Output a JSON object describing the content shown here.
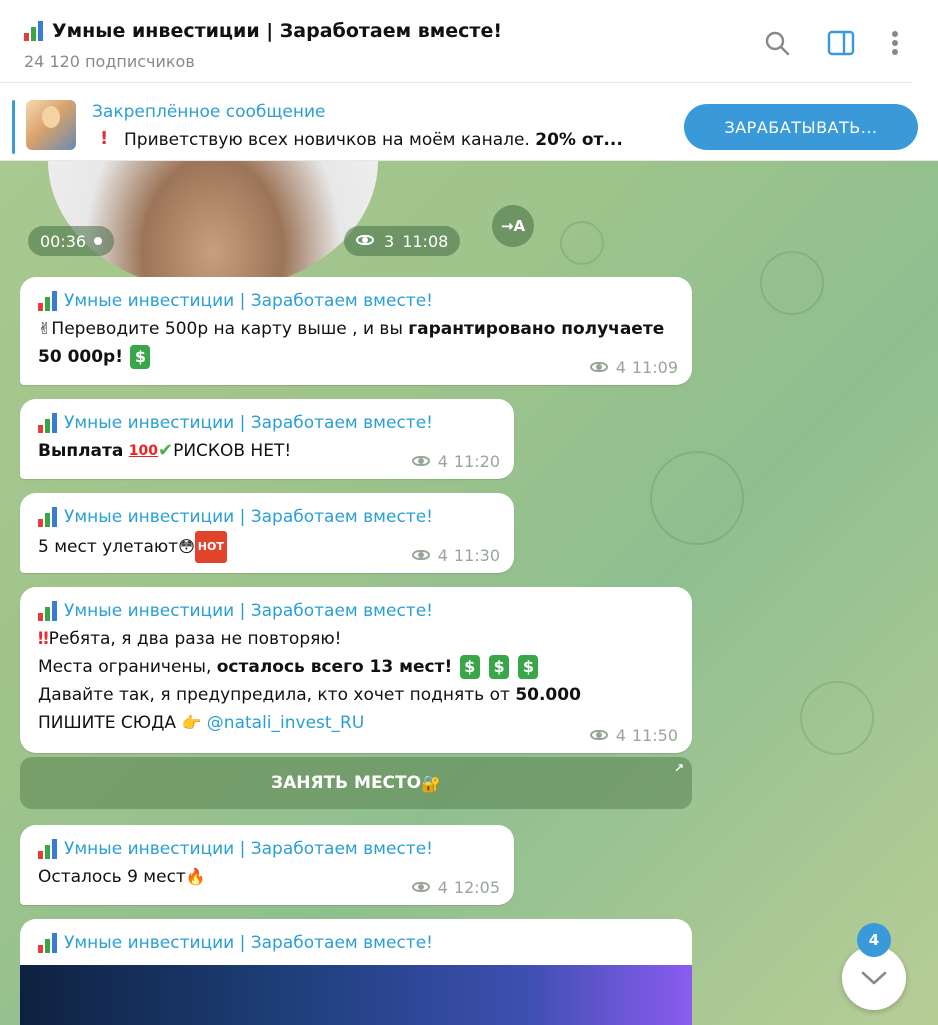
{
  "header": {
    "title": "Умные инвестиции | Заработаем вместе!",
    "subtitle": "24 120 подписчиков",
    "icons": [
      "chart-emoji",
      "search-icon",
      "sidebar-toggle-icon",
      "more-vert-icon"
    ]
  },
  "pinned": {
    "title": "Закреплённое сообщение",
    "text": "Приветствую всех новичков на моём канале.",
    "text_bold": "20% от...",
    "button_label": "ЗАРАБАТЫВАТЬ..."
  },
  "video": {
    "duration": "00:36",
    "views": "3",
    "time": "11:08",
    "forward_label": "→A"
  },
  "channel_name": "Умные инвестиции | Заработаем вместе!",
  "messages": [
    {
      "text_a": "Переводите 500р на карту выше , и вы ",
      "text_bold": "гарантировано получаете 50 000р!",
      "views": "4",
      "time": "11:09"
    },
    {
      "text_bold": "Выплата",
      "text_b": "РИСКОВ НЕТ!",
      "views": "4",
      "time": "11:20"
    },
    {
      "text_a": "5 мест улетают",
      "hot_label": "HOT",
      "views": "4",
      "time": "11:30"
    },
    {
      "line1": "Ребята, я два раза не повторяю!",
      "line2_a": "Места ограничены, ",
      "line2_bold": "осталось всего 13 мест!",
      "line3_a": "Давайте так, я предупредила, кто хочет поднять от ",
      "line3_bold": "50.000",
      "line4_a": "ПИШИТЕ СЮДА",
      "line4_link": "@natali_invest_RU",
      "views": "4",
      "time": "11:50",
      "button_label": "ЗАНЯТЬ МЕСТО"
    },
    {
      "text_a": "Осталось 9 мест",
      "views": "4",
      "time": "12:05"
    }
  ],
  "last_message_sender": "Умные инвестиции | Заработаем вместе!",
  "unread_count": "4",
  "colors": {
    "accent": "#3a9ad9",
    "link": "#2a9fd6",
    "chat_bg": "#a8c98f"
  }
}
